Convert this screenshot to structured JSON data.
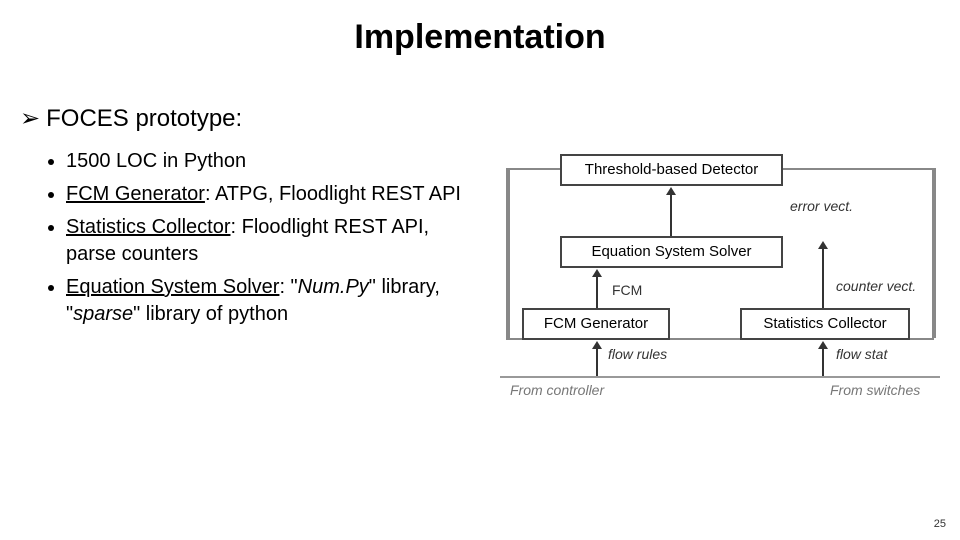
{
  "slide": {
    "title": "Implementation",
    "page_number": "25"
  },
  "main_bullet": {
    "marker": "➢",
    "text": "FOCES prototype:"
  },
  "sub_bullets": [
    {
      "plain": "1500 LOC in Python"
    },
    {
      "underline": "FCM Generator",
      "rest": ": ATPG, Floodlight REST API"
    },
    {
      "underline": "Statistics Collector",
      "rest": ": Floodlight REST API, parse counters"
    },
    {
      "underline": "Equation System Solver",
      "rest_prefix": ": \"",
      "italic1": "Num.Py",
      "mid": "\" library, \"",
      "italic2": "sparse",
      "rest_suffix": "\" library of python"
    }
  ],
  "diagram": {
    "box_detector": "Threshold-based Detector",
    "box_solver": "Equation System Solver",
    "box_fcm": "FCM Generator",
    "box_stats": "Statistics Collector",
    "label_error": "error vect.",
    "label_fcm": "FCM",
    "label_counter": "counter vect.",
    "label_flow_rules": "flow rules",
    "label_flow_stat": "flow stat",
    "bottom_left": "From controller",
    "bottom_right": "From switches"
  }
}
